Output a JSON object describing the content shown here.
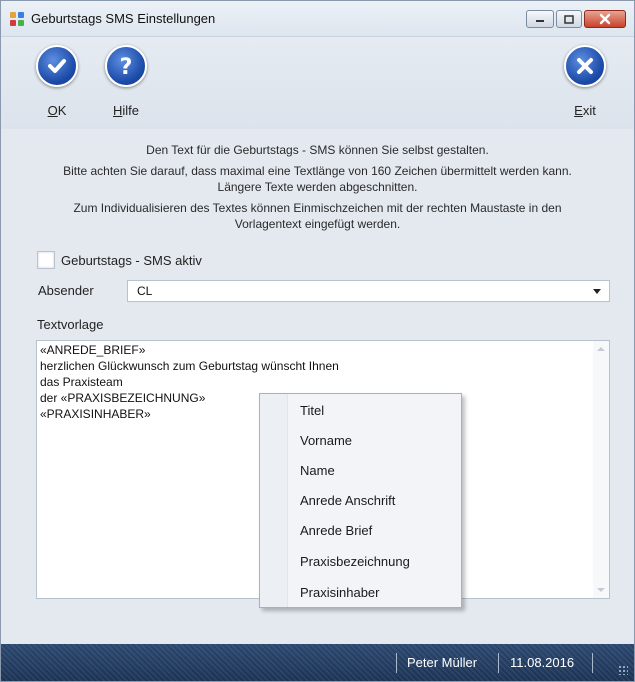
{
  "window": {
    "title": "Geburtstags SMS Einstellungen"
  },
  "toolbar": {
    "ok": {
      "label": "OK",
      "icon": "checkmark-icon"
    },
    "help": {
      "label": "Hilfe",
      "icon": "question-icon"
    },
    "exit": {
      "label": "Exit",
      "icon": "close-icon"
    }
  },
  "info": {
    "line1": "Den Text für die Geburtstags - SMS können Sie selbst gestalten.",
    "line2": "Bitte achten Sie darauf, dass maximal eine Textlänge von 160 Zeichen übermittelt werden kann.",
    "line3": "Längere Texte werden abgeschnitten.",
    "line4": "Zum Individualisieren des Textes können Einmischzeichen mit der rechten Maustaste in den",
    "line5": "Vorlagentext eingefügt werden."
  },
  "form": {
    "sms_active_label": "Geburtstags - SMS aktiv",
    "sms_active_checked": false,
    "sender_label": "Absender",
    "sender_value": "CL",
    "template_label": "Textvorlage",
    "template_lines": [
      "«ANREDE_BRIEF»",
      "herzlichen Glückwunsch zum Geburtstag wünscht Ihnen",
      "das Praxisteam",
      "der «PRAXISBEZEICHNUNG»",
      "«PRAXISINHABER»"
    ]
  },
  "context_menu": {
    "items": [
      "Titel",
      "Vorname",
      "Name",
      "Anrede Anschrift",
      "Anrede Brief",
      "Praxisbezeichnung",
      "Praxisinhaber"
    ]
  },
  "statusbar": {
    "user": "Peter Müller",
    "date": "11.08.2016"
  },
  "colors": {
    "statusbar": "#1d3558",
    "toolbar_icon": "#1b4aa8",
    "close_button": "#c8422b"
  }
}
